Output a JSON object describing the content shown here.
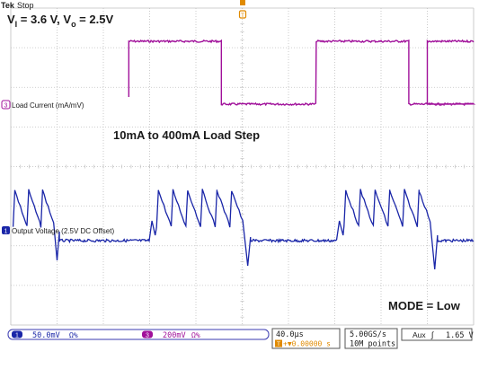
{
  "header": {
    "brand": "Tek",
    "state": "Stop"
  },
  "condition": {
    "vi_symbol": "V",
    "vi_sub": "I",
    "vi_value": " = 3.6 V, ",
    "vo_symbol": "V",
    "vo_sub": "o",
    "vo_value": " = 2.5V"
  },
  "annotations": {
    "load_step": "10mA to 400mA Load Step",
    "mode": "MODE = Low"
  },
  "channels": [
    {
      "marker": "3",
      "label": "Load Current (mA/mV)",
      "color": "#a0109a"
    },
    {
      "marker": "1",
      "label": "Output Voltage (2.5V DC Offset)",
      "color": "#1a26a8"
    }
  ],
  "status_bar": {
    "ch1_marker": "1",
    "ch1_scale": "50.0mV",
    "ch1_suffix": "Ω%",
    "ch3_marker": "3",
    "ch3_scale": "200mV",
    "ch3_suffix": "Ω%",
    "timebase": "40.0µs",
    "trigger_pos": "+▼0.00000 s",
    "sample_rate": "5.00GS/s",
    "record_length": "10M points",
    "trigger_source": "Aux",
    "trigger_slope": "∫",
    "trigger_level": "1.65 V"
  },
  "colors": {
    "grid": "#bfbfbf",
    "ch1": "#1a26a8",
    "ch3": "#a0109a",
    "trigger": "#e08a00",
    "text": "#1a1a1a"
  },
  "chart_data": {
    "type": "line",
    "time_per_div_us": 40,
    "divisions_x": 10,
    "divisions_y": 8,
    "series": [
      {
        "name": "Load Current (mA/mV)",
        "shape": "square",
        "low_mA": 10,
        "high_mA": 400,
        "high_intervals_div": [
          [
            2.5,
            6.0
          ],
          [
            12.5,
            16.0
          ],
          [
            22.5,
            26.0
          ]
        ]
      },
      {
        "name": "Output Voltage (2.5V DC Offset)",
        "shape": "ripple",
        "ripple_mV_pp": 50,
        "pulses_per_burst": 3,
        "burst_intervals_div": [
          [
            0.0,
            2.45
          ],
          [
            7.05,
            12.45
          ],
          [
            17.05,
            22.45
          ]
        ]
      }
    ]
  }
}
